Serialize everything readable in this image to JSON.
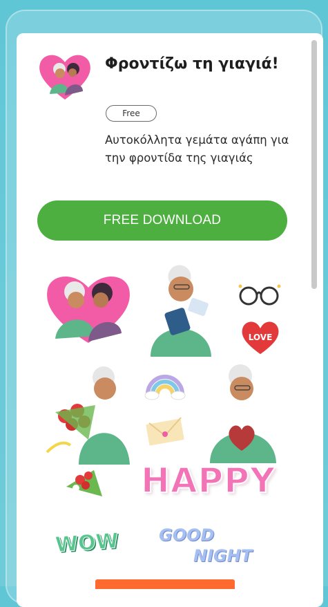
{
  "app": {
    "title": "Φροντίζω τη γιαγιά!",
    "price_badge": "Free",
    "description": "Αυτοκόλλητα γεμάτα αγάπη για την φροντίδα της γιαγιάς",
    "download_label": "FREE DOWNLOAD",
    "icon": "grandma-heart-icon"
  },
  "stickers": {
    "items": [
      {
        "name": "grandma-hug-heart-sticker"
      },
      {
        "name": "grandma-reading-sticker"
      },
      {
        "name": "glasses-sticker"
      },
      {
        "name": "love-heart-sticker"
      },
      {
        "name": "grandma-bouquet-sticker"
      },
      {
        "name": "rainbow-sticker"
      },
      {
        "name": "letter-envelope-sticker"
      },
      {
        "name": "grandma-heart-hands-sticker"
      },
      {
        "name": "flower-bouquet-sticker"
      }
    ],
    "happy_text": "HAPPY",
    "wow_text": "WOW",
    "good_text": "GOOD",
    "night_text": "NIGHT"
  },
  "colors": {
    "background": "#66c9d7",
    "download_button": "#4caf3f",
    "cta_strip": "#ff6a30",
    "happy_text": "#f274b7"
  }
}
